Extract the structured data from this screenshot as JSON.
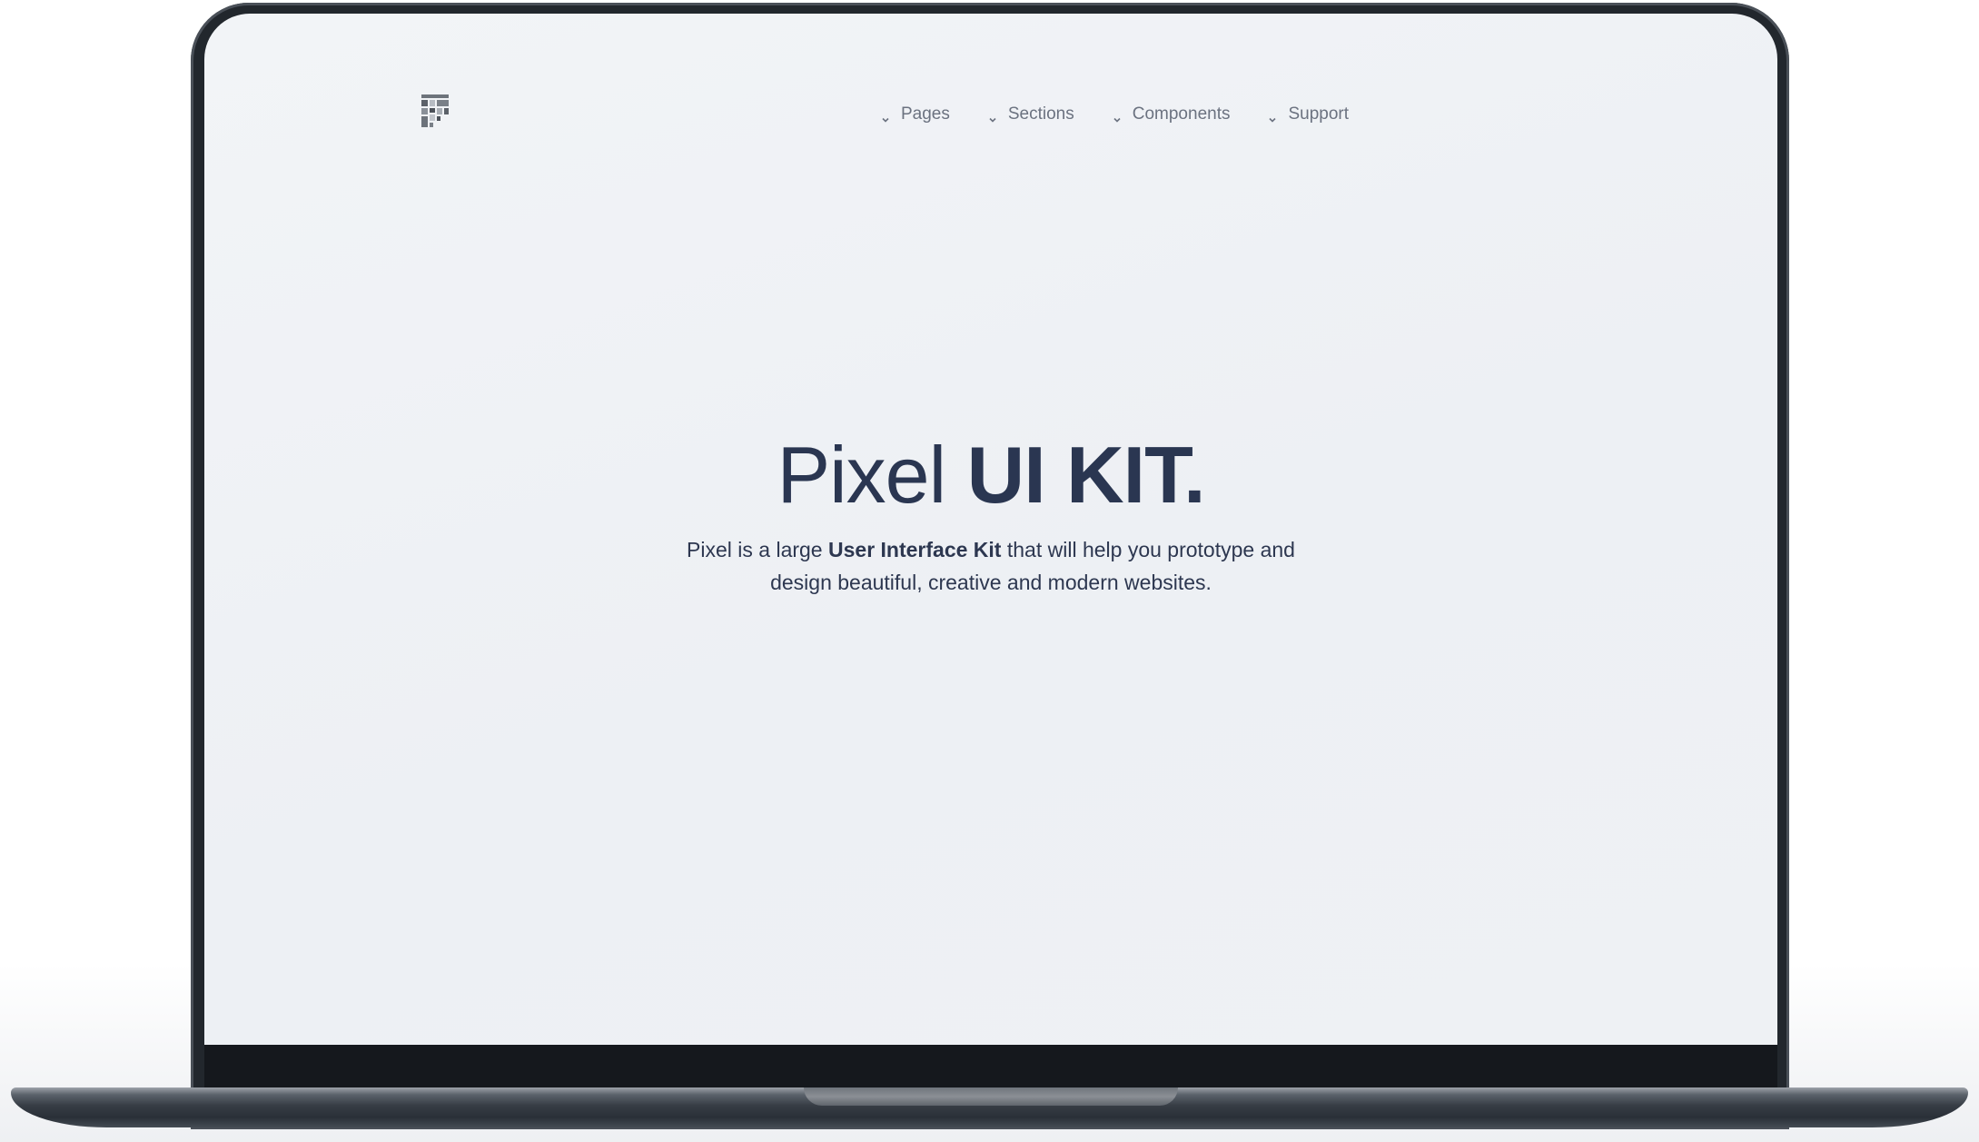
{
  "brand": {
    "logo_icon": "pixel-logo-icon"
  },
  "nav": {
    "items": [
      {
        "label": "Pages",
        "icon": "chevron-down-icon"
      },
      {
        "label": "Sections",
        "icon": "chevron-down-icon"
      },
      {
        "label": "Components",
        "icon": "chevron-down-icon"
      },
      {
        "label": "Support",
        "icon": "chevron-down-icon"
      }
    ]
  },
  "hero": {
    "title_light": "Pixel",
    "title_bold": "UI KIT.",
    "subtitle_pre": "Pixel is a large ",
    "subtitle_bold": "User Interface Kit",
    "subtitle_mid": " that will help you prototype and",
    "subtitle_line2": "design beautiful, creative and modern websites."
  },
  "colors": {
    "heading": "#2a3651",
    "nav_text": "#6b7280",
    "screen_bg": "#eef1f4",
    "bezel": "#22272d"
  }
}
